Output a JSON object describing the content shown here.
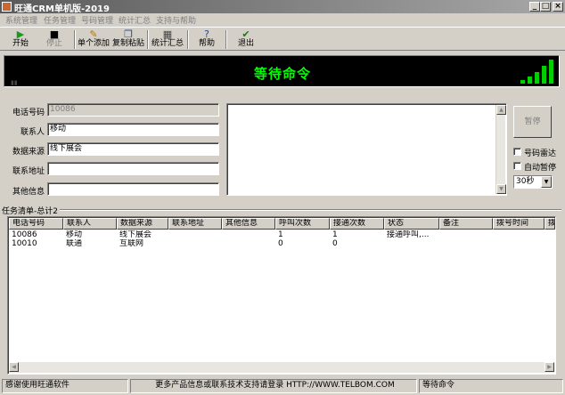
{
  "window": {
    "title": "旺通CRM单机版-2019"
  },
  "menu": [
    "系统管理",
    "任务管理",
    "号码管理",
    "统计汇总",
    "支持与帮助"
  ],
  "toolbar": {
    "start": "开始",
    "stop": "停止",
    "add_single": "单个添加",
    "copy_paste": "复制粘贴",
    "stats": "统计汇总",
    "help": "帮助",
    "exit": "退出"
  },
  "display": {
    "message": "等待命令"
  },
  "form": {
    "phone_label": "电话号码",
    "phone_value": "10086",
    "contact_label": "联系人",
    "contact_value": "移动",
    "source_label": "数据来源",
    "source_value": "线下展会",
    "address_label": "联系地址",
    "address_value": "",
    "other_label": "其他信息",
    "other_value": ""
  },
  "controls": {
    "pause_label": "暂停",
    "number_flash_label": "号码雷达",
    "auto_pause_label": "自动暂停",
    "interval_value": "30秒"
  },
  "tasklist": {
    "group_label": "任务清单-总计2",
    "columns": [
      "电话号码",
      "联系人",
      "数据来源",
      "联系地址",
      "其他信息",
      "呼叫次数",
      "接通次数",
      "状态",
      "备注",
      "拨号时间",
      "拨"
    ],
    "rows": [
      [
        "10086",
        "移动",
        "线下展会",
        "",
        "",
        "1",
        "1",
        "接通呼叫,...",
        "",
        "",
        ""
      ],
      [
        "10010",
        "联通",
        "互联网",
        "",
        "",
        "0",
        "0",
        "",
        "",
        "",
        ""
      ]
    ]
  },
  "statusbar": {
    "welcome": "感谢使用旺通软件",
    "info": "更多产品信息或联系技术支持请登录 HTTP://WWW.TELBOM.COM",
    "state": "等待命令"
  },
  "colors": {
    "display_bg": "#000000",
    "display_text": "#00ff00",
    "signal": "#00d000",
    "window_bg": "#d4d0c8"
  }
}
